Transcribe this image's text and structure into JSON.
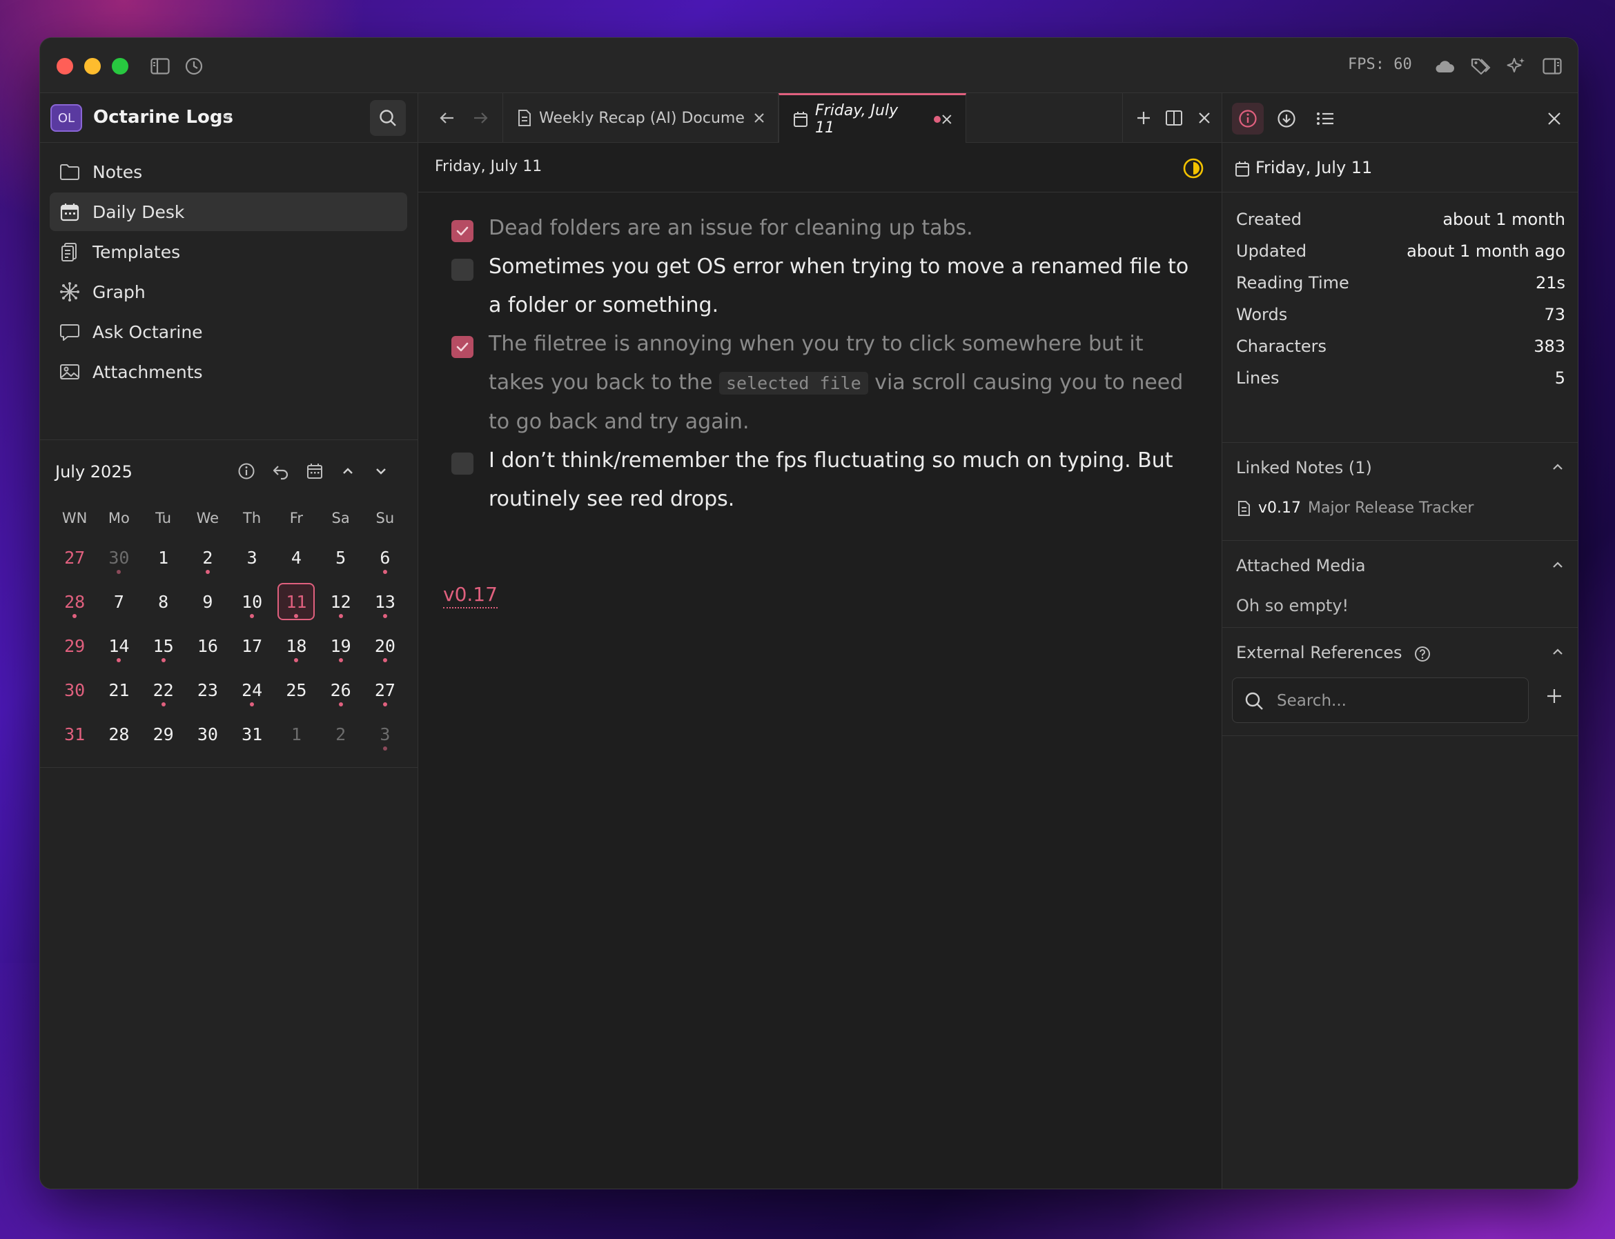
{
  "titlebar": {
    "fps": "FPS: 60"
  },
  "workspace": {
    "initials": "OL",
    "name": "Octarine Logs"
  },
  "sidebar": {
    "items": [
      {
        "label": "Notes",
        "icon": "folder-icon",
        "active": false
      },
      {
        "label": "Daily Desk",
        "icon": "calendar-icon",
        "active": true
      },
      {
        "label": "Templates",
        "icon": "templates-icon",
        "active": false
      },
      {
        "label": "Graph",
        "icon": "graph-icon",
        "active": false
      },
      {
        "label": "Ask Octarine",
        "icon": "chat-icon",
        "active": false
      },
      {
        "label": "Attachments",
        "icon": "image-icon",
        "active": false
      }
    ]
  },
  "calendar": {
    "title": "July 2025",
    "headers": [
      "WN",
      "Mo",
      "Tu",
      "We",
      "Th",
      "Fr",
      "Sa",
      "Su"
    ],
    "weeks": [
      {
        "wn": "27",
        "days": [
          {
            "d": "30",
            "muted": true,
            "dot": true
          },
          {
            "d": "1"
          },
          {
            "d": "2",
            "dot": true
          },
          {
            "d": "3"
          },
          {
            "d": "4"
          },
          {
            "d": "5"
          },
          {
            "d": "6",
            "dot": true
          }
        ],
        "wn_dot": false
      },
      {
        "wn": "28",
        "days": [
          {
            "d": "7"
          },
          {
            "d": "8"
          },
          {
            "d": "9"
          },
          {
            "d": "10",
            "dot": true
          },
          {
            "d": "11",
            "today": true,
            "dot": true
          },
          {
            "d": "12",
            "dot": true
          },
          {
            "d": "13",
            "dot": true
          }
        ],
        "wn_dot": true
      },
      {
        "wn": "29",
        "days": [
          {
            "d": "14",
            "dot": true
          },
          {
            "d": "15",
            "dot": true
          },
          {
            "d": "16"
          },
          {
            "d": "17"
          },
          {
            "d": "18",
            "dot": true
          },
          {
            "d": "19",
            "dot": true
          },
          {
            "d": "20",
            "dot": true
          }
        ],
        "wn_dot": false
      },
      {
        "wn": "30",
        "days": [
          {
            "d": "21"
          },
          {
            "d": "22",
            "dot": true
          },
          {
            "d": "23"
          },
          {
            "d": "24",
            "dot": true
          },
          {
            "d": "25"
          },
          {
            "d": "26",
            "dot": true
          },
          {
            "d": "27",
            "dot": true
          }
        ],
        "wn_dot": false
      },
      {
        "wn": "31",
        "days": [
          {
            "d": "28"
          },
          {
            "d": "29"
          },
          {
            "d": "30"
          },
          {
            "d": "31"
          },
          {
            "d": "1",
            "muted": true
          },
          {
            "d": "2",
            "muted": true
          },
          {
            "d": "3",
            "muted": true,
            "dot": true
          }
        ],
        "wn_dot": false
      }
    ]
  },
  "tabs": [
    {
      "label": "Weekly Recap (AI) Docume",
      "icon": "document-icon",
      "active": false
    },
    {
      "label": "Friday, July 11",
      "icon": "calendar-icon",
      "active": true,
      "modified": true
    }
  ],
  "document": {
    "title": "Friday, July 11",
    "tasks": [
      {
        "done": true,
        "parts": [
          {
            "t": "Dead folders are an issue for cleaning up tabs."
          }
        ]
      },
      {
        "done": false,
        "parts": [
          {
            "t": "Sometimes you get OS error when trying to move a renamed file to a folder or something."
          }
        ]
      },
      {
        "done": true,
        "parts": [
          {
            "t": "The filetree is annoying when you try to click somewhere but it takes you back to the "
          },
          {
            "t": "selected file",
            "code": true
          },
          {
            "t": " via scroll causing you to need to go back and try again."
          }
        ]
      },
      {
        "done": false,
        "parts": [
          {
            "t": "I don’t think/remember the fps fluctuating so much on typing. But routinely see red drops."
          }
        ]
      }
    ],
    "tag": "v0.17"
  },
  "info_panel": {
    "title": "Friday, July 11",
    "meta": [
      {
        "key": "Created",
        "value": "about 1 month"
      },
      {
        "key": "Updated",
        "value": "about 1 month ago"
      },
      {
        "key": "Reading Time",
        "value": "21s"
      },
      {
        "key": "Words",
        "value": "73"
      },
      {
        "key": "Characters",
        "value": "383"
      },
      {
        "key": "Lines",
        "value": "5"
      }
    ],
    "linked_notes": {
      "title": "Linked Notes (1)",
      "items": [
        {
          "version": "v0.17",
          "title": "Major Release Tracker"
        }
      ]
    },
    "attached_media": {
      "title": "Attached Media",
      "empty": "Oh so empty!"
    },
    "external_refs": {
      "title": "External References",
      "search_placeholder": "Search..."
    }
  },
  "colors": {
    "accent": "#e0607e",
    "window_bg": "#1e1e1e",
    "panel_bg": "#232323"
  }
}
